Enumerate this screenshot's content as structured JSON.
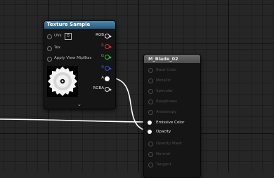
{
  "texture_sample": {
    "title": "Texture Sample",
    "inputs": [
      {
        "label": "UVs",
        "value": "0"
      },
      {
        "label": "Tex"
      },
      {
        "label": "Apply View MipBias"
      }
    ],
    "outputs": [
      {
        "label": "RGB",
        "color": "#e0e0e0"
      },
      {
        "label": "R",
        "color": "#e03030"
      },
      {
        "label": "G",
        "color": "#30c030"
      },
      {
        "label": "B",
        "color": "#3050e0"
      },
      {
        "label": "A",
        "color": "#dddddd"
      },
      {
        "label": "RGBA",
        "color": "#e0e0e0"
      }
    ],
    "preview_icon": "saw-blade-texture",
    "collapse_icon": "chevron-down-icon"
  },
  "material": {
    "title": "M_Blade_02",
    "inputs": [
      {
        "label": "Base Color",
        "active": false
      },
      {
        "label": "Metallic",
        "active": false
      },
      {
        "label": "Specular",
        "active": false
      },
      {
        "label": "Roughness",
        "active": false
      },
      {
        "label": "Anisotropy",
        "active": false
      },
      {
        "label": "Emissive Color",
        "active": true
      },
      {
        "label": "Opacity",
        "active": true
      },
      {
        "label": "Opacity Mask",
        "active": false
      },
      {
        "label": "Normal",
        "active": false
      },
      {
        "label": "Tangent",
        "active": false
      }
    ]
  },
  "colors": {
    "header_texture": "#3a7aa0",
    "header_material": "#5c5c5c",
    "wire": "#ffffff",
    "background": "#262626"
  }
}
